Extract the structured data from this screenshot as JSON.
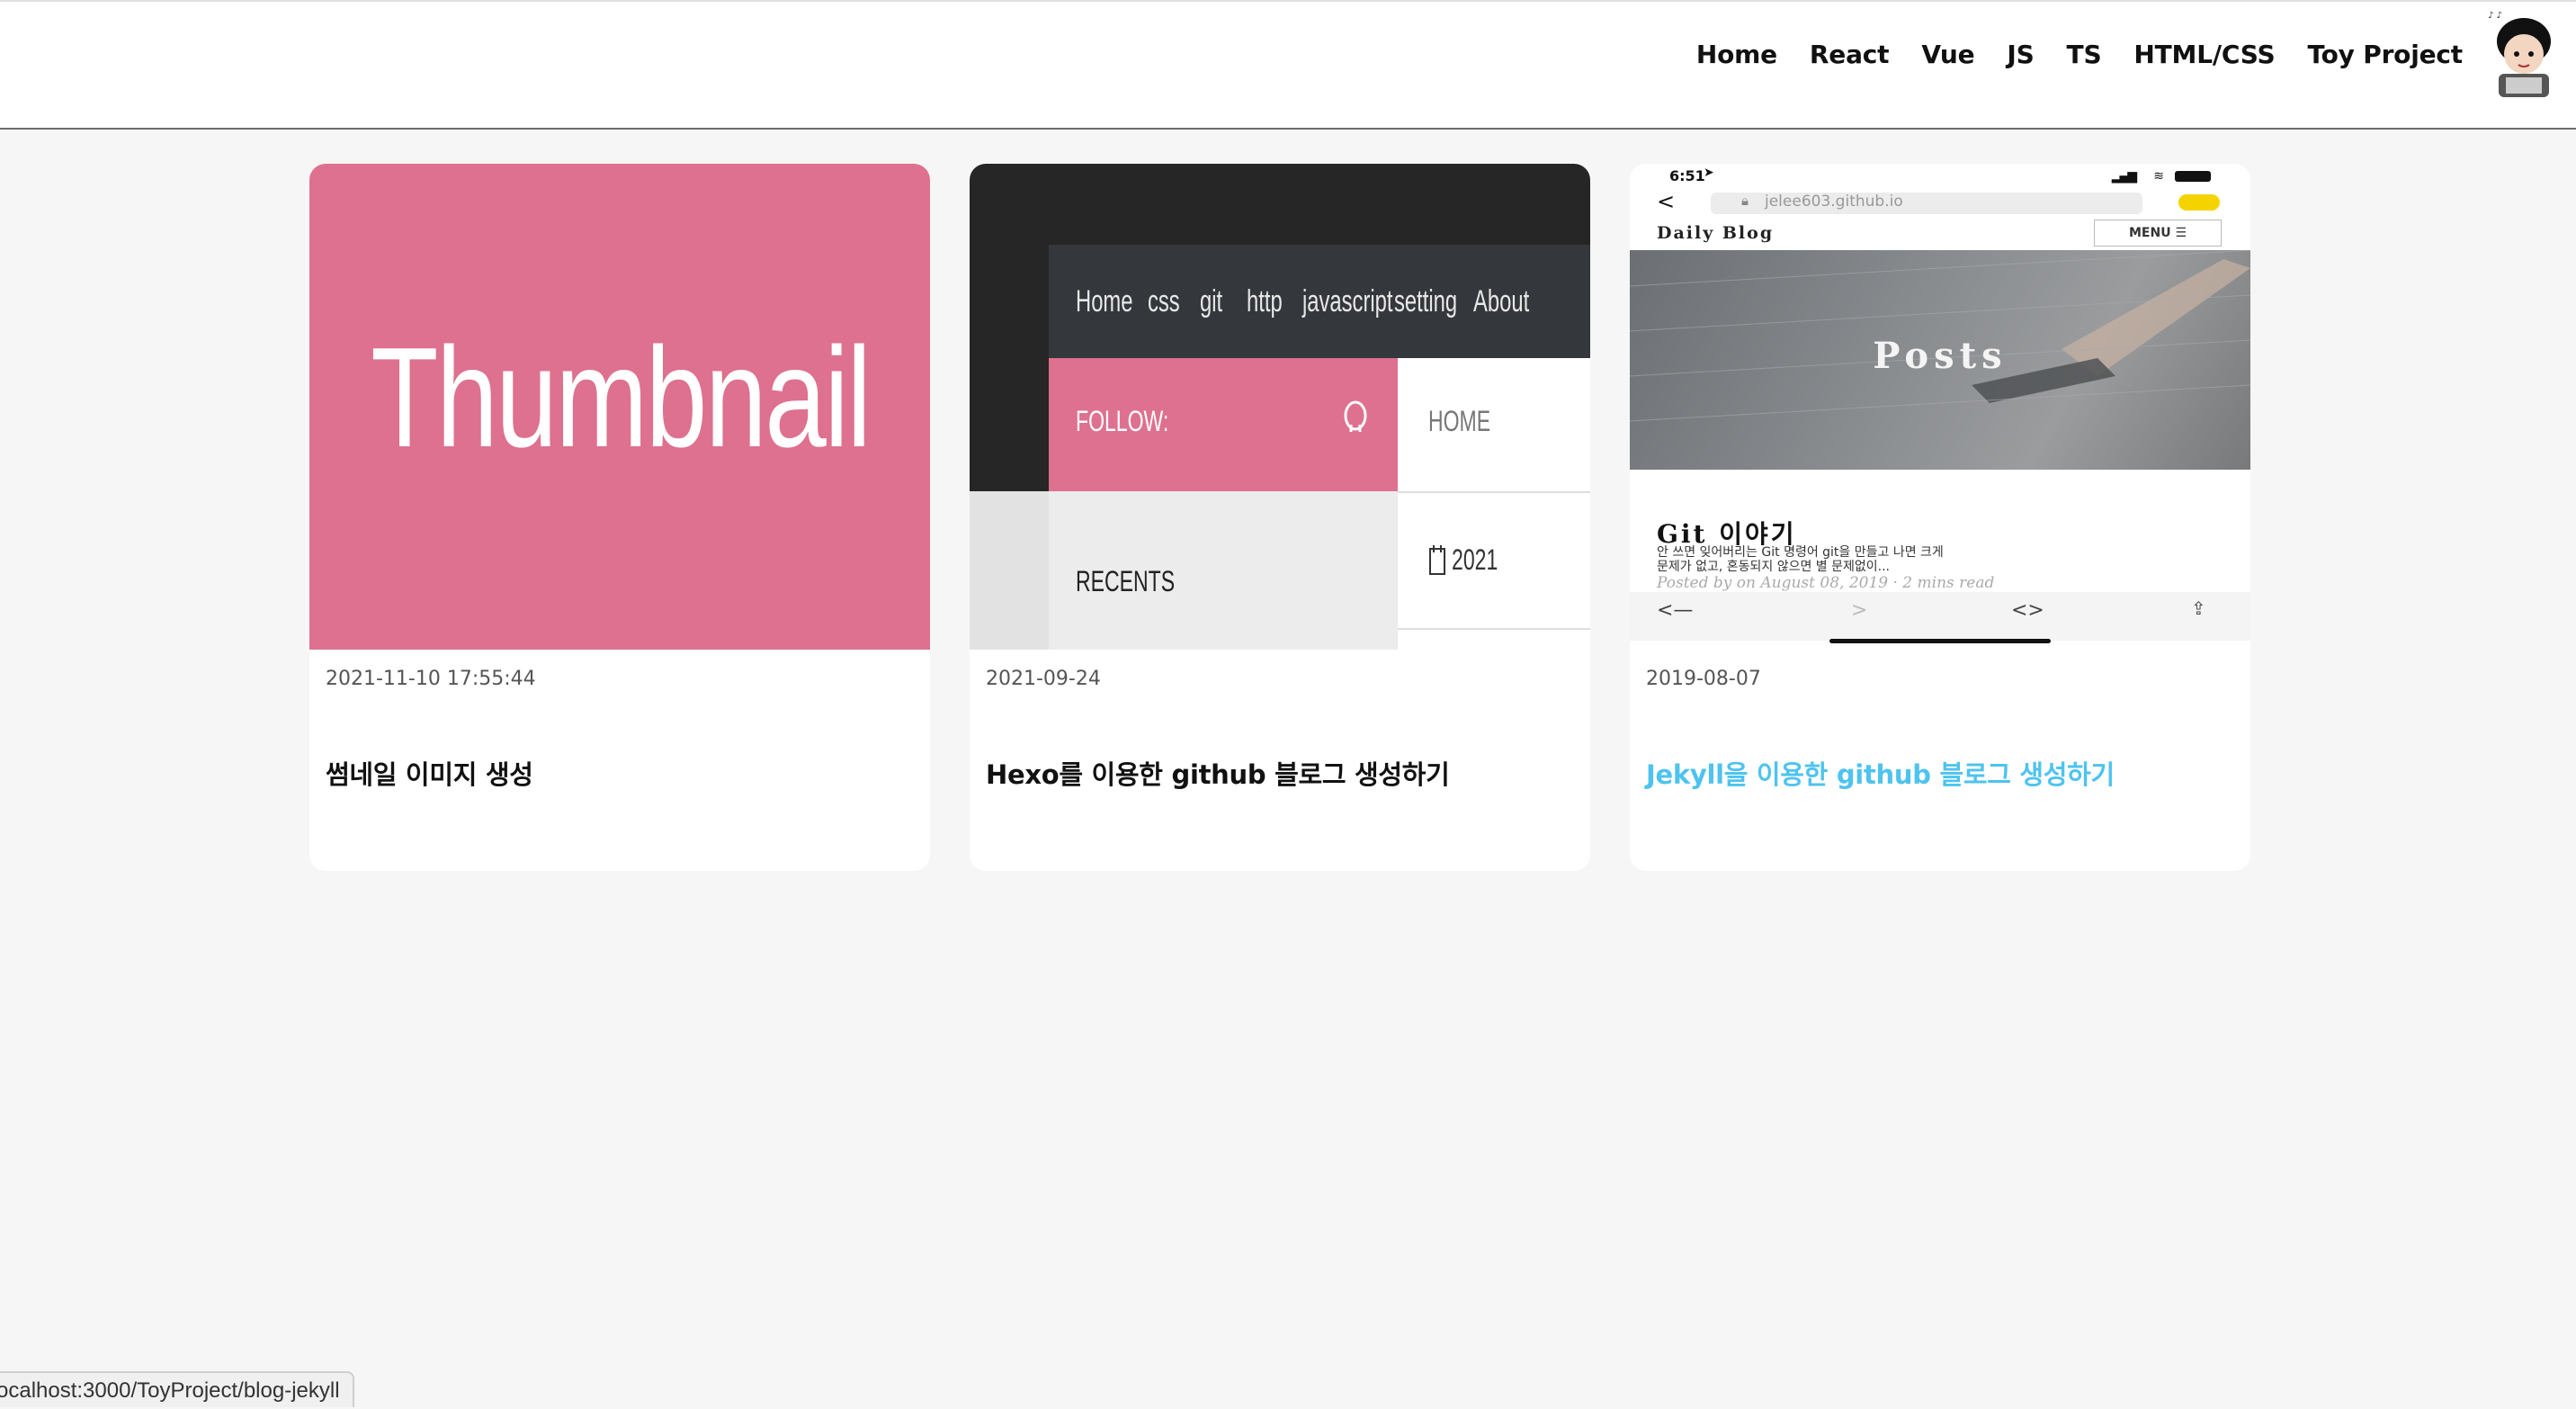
{
  "nav": {
    "items": [
      "Home",
      "React",
      "Vue",
      "JS",
      "TS",
      "HTML/CSS",
      "Toy Project"
    ]
  },
  "cards": [
    {
      "date": "2021-11-10 17:55:44",
      "title": "썸네일 이미지 생성",
      "thumbnail": {
        "text": "Thumbnail",
        "color": "#de718f"
      }
    },
    {
      "date": "2021-09-24",
      "title": "Hexo를 이용한 github 블로그 생성하기",
      "thumbnail": {
        "nav": [
          "Home",
          "css",
          "git",
          "http",
          "javascript",
          "setting",
          "About"
        ],
        "follow": "FOLLOW:",
        "recents": "RECENTS",
        "home": "HOME",
        "year": "2021"
      }
    },
    {
      "date": "2019-08-07",
      "title": "Jekyll을 이용한 github 블로그 생성하기",
      "title_color": "#4ec3ef",
      "thumbnail": {
        "time": "6:51",
        "url": "jelee603.github.io",
        "blog_name": "Daily Blog",
        "menu": "MENU ☰",
        "hero": "Posts",
        "post_title": "Git 이야기",
        "excerpt_1": "안 쓰면 잊어버리는 Git 명령어 git을 만들고 나면 크게",
        "excerpt_2": "문제가 없고, 혼동되지 않으면 별 문제없이...",
        "meta": "Posted by on August 08, 2019 · 2 mins read"
      }
    }
  ],
  "status_url": "ocalhost:3000/ToyProject/blog-jekyll"
}
